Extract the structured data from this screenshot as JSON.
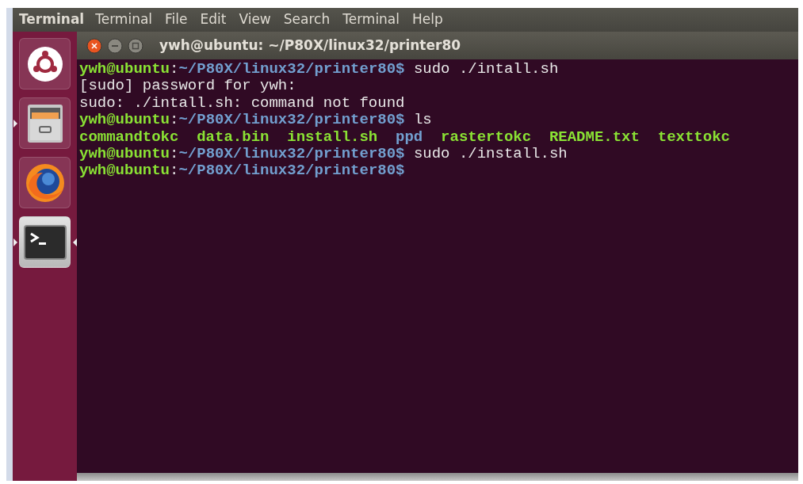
{
  "top_bar": {
    "app_name": "Terminal",
    "menu": [
      "Terminal",
      "File",
      "Edit",
      "View",
      "Search",
      "Terminal",
      "Help"
    ]
  },
  "launcher": [
    {
      "kind": "dash",
      "running": false,
      "focused": false
    },
    {
      "kind": "files",
      "running": true,
      "focused": false
    },
    {
      "kind": "browser",
      "running": false,
      "focused": false
    },
    {
      "kind": "terminal",
      "running": true,
      "focused": true
    }
  ],
  "window": {
    "title": "ywh@ubuntu: ~/P80X/linux32/printer80"
  },
  "terminal_lines": [
    [
      {
        "kind": "user",
        "text": "ywh@ubuntu"
      },
      {
        "kind": "text",
        "text": ":"
      },
      {
        "kind": "path",
        "text": "~/P80X/linux32/printer80$"
      },
      {
        "kind": "text",
        "text": " sudo ./intall.sh"
      }
    ],
    [
      {
        "kind": "text",
        "text": "[sudo] password for ywh:"
      }
    ],
    [
      {
        "kind": "text",
        "text": "sudo: ./intall.sh: command not found"
      }
    ],
    [
      {
        "kind": "user",
        "text": "ywh@ubuntu"
      },
      {
        "kind": "text",
        "text": ":"
      },
      {
        "kind": "path",
        "text": "~/P80X/linux32/printer80$"
      },
      {
        "kind": "text",
        "text": " ls"
      }
    ],
    [
      {
        "kind": "exec",
        "text": "commandtokc"
      },
      {
        "kind": "exec",
        "text": "data.bin"
      },
      {
        "kind": "exec",
        "text": "install.sh"
      },
      {
        "kind": "dir",
        "text": "ppd"
      },
      {
        "kind": "exec",
        "text": "rastertokc"
      },
      {
        "kind": "exec",
        "text": "README.txt"
      },
      {
        "kind": "exec",
        "text": "texttokc"
      }
    ],
    [
      {
        "kind": "user",
        "text": "ywh@ubuntu"
      },
      {
        "kind": "text",
        "text": ":"
      },
      {
        "kind": "path",
        "text": "~/P80X/linux32/printer80$"
      },
      {
        "kind": "text",
        "text": " sudo ./install.sh"
      }
    ],
    [
      {
        "kind": "user",
        "text": "ywh@ubuntu"
      },
      {
        "kind": "text",
        "text": ":"
      },
      {
        "kind": "path",
        "text": "~/P80X/linux32/printer80$"
      }
    ]
  ]
}
